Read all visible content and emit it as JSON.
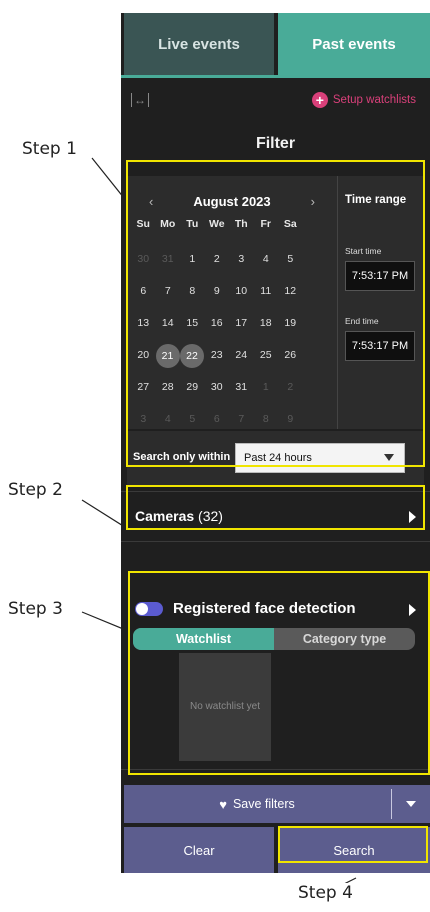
{
  "tabs": {
    "live": "Live events",
    "past": "Past events"
  },
  "toolbar": {
    "watchlists_link": "Setup watchlists"
  },
  "filter": {
    "title": "Filter"
  },
  "calendar": {
    "month_label": "August 2023",
    "prev_icon": "chevron-left",
    "next_icon": "chevron-right",
    "weekdays": [
      "Su",
      "Mo",
      "Tu",
      "We",
      "Th",
      "Fr",
      "Sa"
    ],
    "days": [
      [
        "30",
        "31",
        "1",
        "2",
        "3",
        "4",
        "5"
      ],
      [
        "6",
        "7",
        "8",
        "9",
        "10",
        "11",
        "12"
      ],
      [
        "13",
        "14",
        "15",
        "16",
        "17",
        "18",
        "19"
      ],
      [
        "20",
        "21",
        "22",
        "23",
        "24",
        "25",
        "26"
      ],
      [
        "27",
        "28",
        "29",
        "30",
        "31",
        "1",
        "2"
      ],
      [
        "3",
        "4",
        "5",
        "6",
        "7",
        "8",
        "9"
      ]
    ],
    "selected_days": [
      "21",
      "22"
    ]
  },
  "time_range": {
    "title": "Time range",
    "start_label": "Start time",
    "start_value": "7:53:17 PM",
    "end_label": "End time",
    "end_value": "7:53:17 PM"
  },
  "search_within": {
    "label": "Search only within",
    "selected": "Past 24 hours"
  },
  "cameras": {
    "label": "Cameras",
    "count": "(32)"
  },
  "face_detection": {
    "label": "Registered face detection",
    "toggle_on": false,
    "tabs": [
      "Watchlist",
      "Category type"
    ],
    "active_tab": "Watchlist",
    "empty_text": "No watchlist yet"
  },
  "actions": {
    "save": "Save filters",
    "clear": "Clear",
    "search": "Search"
  },
  "callouts": {
    "step1": "Step 1",
    "step2": "Step 2",
    "step3": "Step 3",
    "step4": "Step 4"
  },
  "colors": {
    "accent": "#49ab98",
    "button": "#5c5d8e",
    "highlight": "#f0e500",
    "pink": "#d9407a"
  }
}
